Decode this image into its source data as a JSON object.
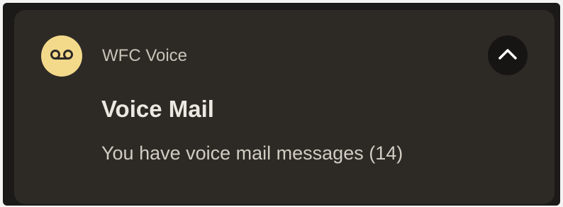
{
  "notification": {
    "app_name": "WFC Voice",
    "app_icon": "voicemail-icon",
    "title": "Voice Mail",
    "message": "You have voice mail messages (14)",
    "collapse_icon": "chevron-up-icon"
  },
  "colors": {
    "card_background": "#2d2a26",
    "icon_background": "#f3d98a",
    "button_background": "#161513"
  }
}
